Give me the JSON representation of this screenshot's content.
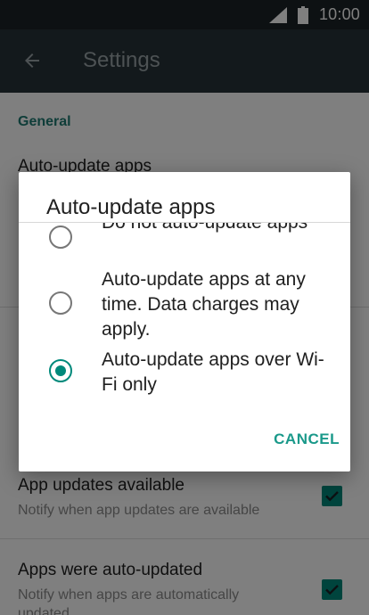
{
  "status_bar": {
    "time": "10:00"
  },
  "app_bar": {
    "title": "Settings"
  },
  "settings": {
    "section_general": "General",
    "auto_update_title": "Auto-update apps",
    "app_updates_title": "App updates available",
    "app_updates_subtitle": "Notify when app updates are available",
    "auto_updated_title": "Apps were auto-updated",
    "auto_updated_subtitle": "Notify when apps are automatically updated"
  },
  "dialog": {
    "title": "Auto-update apps",
    "options": [
      {
        "label": "Do not auto-update apps",
        "selected": false
      },
      {
        "label": "Auto-update apps at any time. Data charges may apply.",
        "selected": false
      },
      {
        "label": "Auto-update apps over Wi-Fi only",
        "selected": true
      }
    ],
    "cancel_label": "CANCEL"
  },
  "colors": {
    "accent": "#00897b",
    "app_bar": "#263238",
    "status_bar": "#1a2226"
  }
}
